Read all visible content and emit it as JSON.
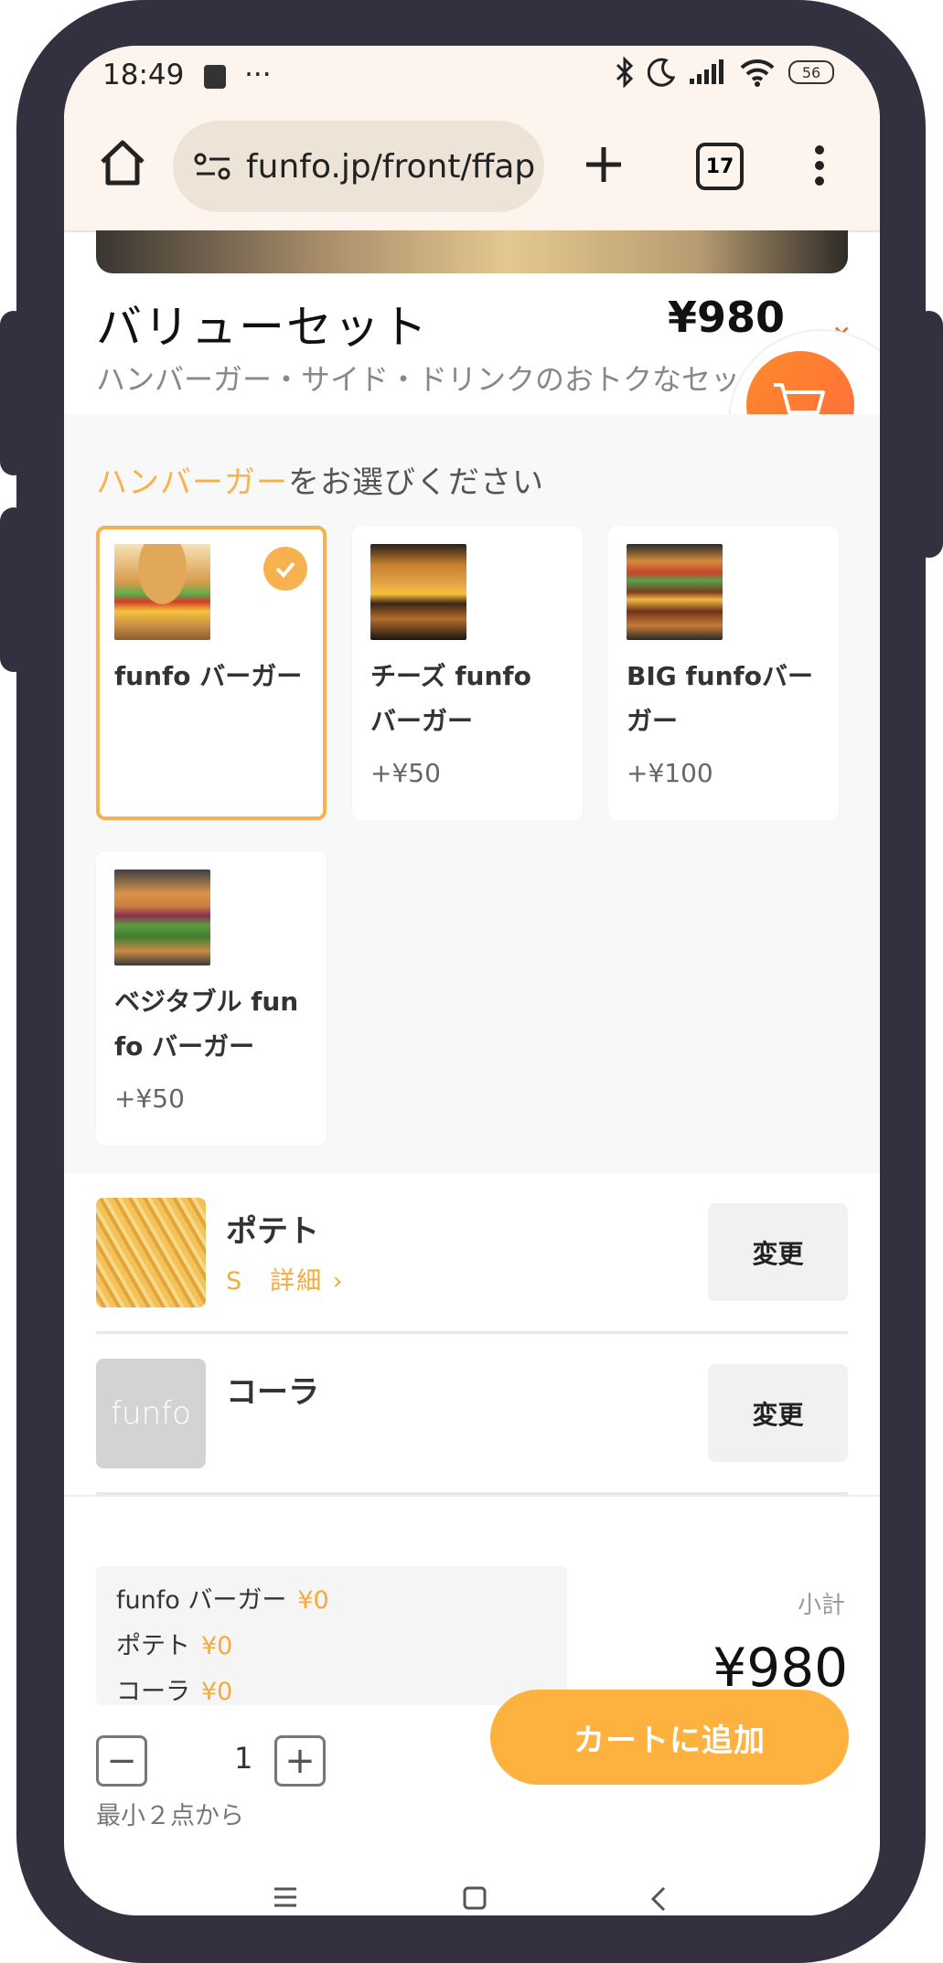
{
  "status_bar": {
    "time": "18:49",
    "dots": "···",
    "battery": "56"
  },
  "browser": {
    "url": "funfo.jp/front/ffap",
    "tab_count": "17"
  },
  "product": {
    "title": "バリューセット",
    "price": "¥980",
    "subtitle": "ハンバーガー・サイド・ドリンクのおトクなセット"
  },
  "burger_section": {
    "prompt_highlight": "ハンバーガー",
    "prompt_rest": "をお選びください",
    "options": [
      {
        "name": "funfo バーガー",
        "extra": "",
        "selected": true
      },
      {
        "name": "チーズ funfo バーガー",
        "extra": "+¥50",
        "selected": false
      },
      {
        "name": "BIG funfoバーガー",
        "extra": "+¥100",
        "selected": false
      },
      {
        "name": "ベジタブル funfo バーガー",
        "extra": "+¥50",
        "selected": false
      }
    ]
  },
  "sides": [
    {
      "name": "ポテト",
      "size": "S",
      "detail": "詳細",
      "change": "変更"
    },
    {
      "name": "コーラ",
      "placeholder_logo": "funfo",
      "change": "変更"
    }
  ],
  "summary": {
    "lines": [
      {
        "name": "funfo バーガー",
        "value": "¥0"
      },
      {
        "name": "ポテト",
        "value": "¥0"
      },
      {
        "name": "コーラ",
        "value": "¥0"
      }
    ],
    "subtotal_label": "小計",
    "subtotal_value": "¥980"
  },
  "quantity": {
    "value": "1",
    "minus": "−",
    "plus": "+",
    "min_note": "最小２点から"
  },
  "add_to_cart": "カートに追加",
  "colors": {
    "accent": "#fdb13e",
    "cart_fab": "#ff7a33",
    "frame": "#33313f"
  }
}
